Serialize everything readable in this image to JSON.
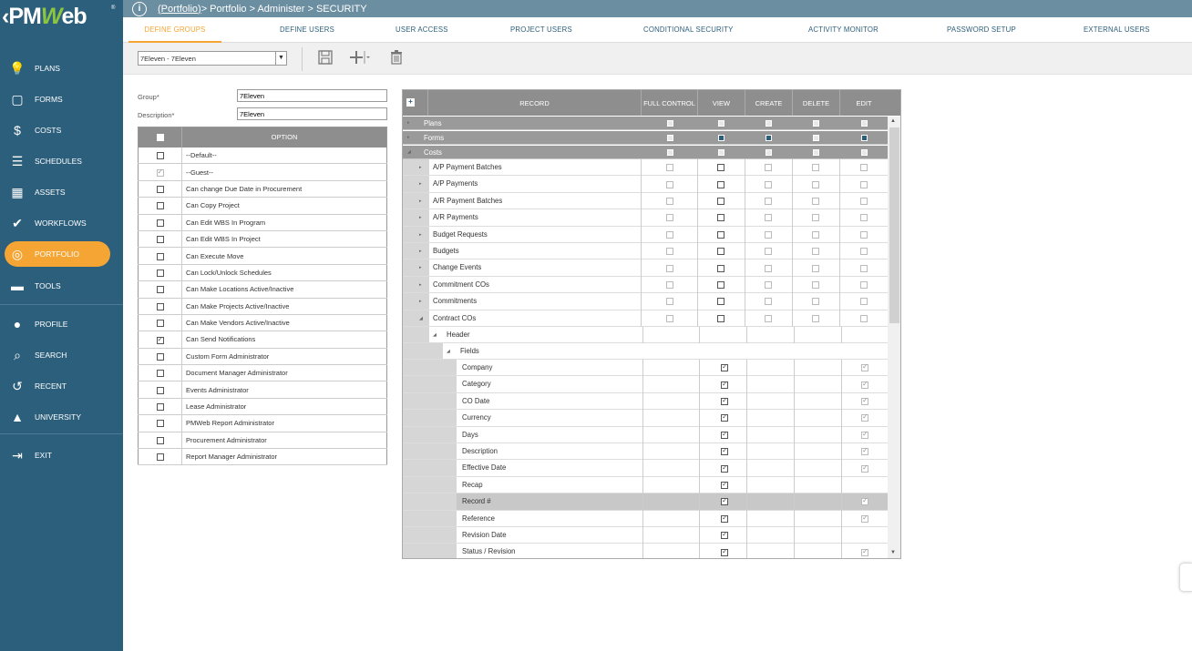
{
  "app": {
    "logo": "PMWeb",
    "reg": "®"
  },
  "breadcrumb": {
    "link": "(Portfolio)",
    "rest": " > Portfolio > Administer > SECURITY"
  },
  "nav": [
    {
      "label": "PLANS",
      "icon": "lightbulb-icon",
      "glyph": "💡"
    },
    {
      "label": "FORMS",
      "icon": "forms-icon",
      "glyph": "▢"
    },
    {
      "label": "COSTS",
      "icon": "dollar-icon",
      "glyph": "$"
    },
    {
      "label": "SCHEDULES",
      "icon": "schedules-icon",
      "glyph": "☰"
    },
    {
      "label": "ASSETS",
      "icon": "building-icon",
      "glyph": "▦"
    },
    {
      "label": "WORKFLOWS",
      "icon": "check-icon",
      "glyph": "✔"
    },
    {
      "label": "PORTFOLIO",
      "icon": "globe-icon",
      "glyph": "◎"
    },
    {
      "label": "TOOLS",
      "icon": "briefcase-icon",
      "glyph": "▬"
    },
    {
      "label": "PROFILE",
      "icon": "person-icon",
      "glyph": "●"
    },
    {
      "label": "SEARCH",
      "icon": "search-icon",
      "glyph": "⌕"
    },
    {
      "label": "RECENT",
      "icon": "history-icon",
      "glyph": "↺"
    },
    {
      "label": "UNIVERSITY",
      "icon": "graduation-cap-icon",
      "glyph": "▲"
    },
    {
      "label": "EXIT",
      "icon": "exit-icon",
      "glyph": "⇥"
    }
  ],
  "tabs": [
    "DEFINE GROUPS",
    "DEFINE USERS",
    "USER ACCESS",
    "PROJECT USERS",
    "CONDITIONAL SECURITY",
    "ACTIVITY MONITOR",
    "PASSWORD SETUP",
    "EXTERNAL USERS"
  ],
  "toolbar": {
    "group_value": "7Eleven - 7Eleven"
  },
  "form": {
    "group_label": "Group*",
    "group_value": "7Eleven",
    "desc_label": "Description*",
    "desc_value": "7Eleven"
  },
  "options": {
    "header": "OPTION",
    "rows": [
      {
        "label": "--Default--",
        "checked": false
      },
      {
        "label": "--Guest--",
        "checked": true,
        "light": true
      },
      {
        "label": "Can change Due Date in Procurement",
        "checked": false
      },
      {
        "label": "Can Copy Project",
        "checked": false
      },
      {
        "label": "Can Edit WBS In Program",
        "checked": false
      },
      {
        "label": "Can Edit WBS In Project",
        "checked": false
      },
      {
        "label": "Can Execute Move",
        "checked": false
      },
      {
        "label": "Can Lock/Unlock Schedules",
        "checked": false
      },
      {
        "label": "Can Make Locations Active/Inactive",
        "checked": false
      },
      {
        "label": "Can Make Projects Active/Inactive",
        "checked": false
      },
      {
        "label": "Can Make Vendors Active/Inactive",
        "checked": false
      },
      {
        "label": "Can Send Notifications",
        "checked": true
      },
      {
        "label": "Custom Form Administrator",
        "checked": false
      },
      {
        "label": "Document Manager Administrator",
        "checked": false
      },
      {
        "label": "Events Administrator",
        "checked": false
      },
      {
        "label": "Lease Administrator",
        "checked": false
      },
      {
        "label": "PMWeb Report Administrator",
        "checked": false
      },
      {
        "label": "Procurement Administrator",
        "checked": false
      },
      {
        "label": "Report Manager Administrator",
        "checked": false
      }
    ]
  },
  "grid": {
    "headers": {
      "record": "RECORD",
      "full": "FULL CONTROL",
      "view": "VIEW",
      "create": "CREATE",
      "delete": "DELETE",
      "edit": "EDIT"
    },
    "top_rows": [
      {
        "label": "Plans",
        "checks": [
          0,
          0,
          0,
          0,
          0
        ]
      },
      {
        "label": "Forms",
        "checks": [
          0,
          1,
          1,
          0,
          1
        ]
      },
      {
        "label": "Costs",
        "checks": [
          0,
          0,
          0,
          0,
          0
        ]
      }
    ],
    "cost_rows": [
      "A/P Payment Batches",
      "A/P Payments",
      "A/R Payment Batches",
      "A/R Payments",
      "Budget Requests",
      "Budgets",
      "Change Events",
      "Commitment COs",
      "Commitments",
      "Contract COs"
    ],
    "header_row": "Header",
    "fields_row": "Fields",
    "field_rows": [
      {
        "label": "Company",
        "view": true,
        "edit": true
      },
      {
        "label": "Category",
        "view": true,
        "edit": true
      },
      {
        "label": "CO Date",
        "view": true,
        "edit": true
      },
      {
        "label": "Currency",
        "view": true,
        "edit": true
      },
      {
        "label": "Days",
        "view": true,
        "edit": true
      },
      {
        "label": "Description",
        "view": true,
        "edit": true
      },
      {
        "label": "Effective Date",
        "view": true,
        "edit": true
      },
      {
        "label": "Recap",
        "view": true,
        "edit": false
      },
      {
        "label": "Record #",
        "view": true,
        "edit": true,
        "selected": true
      },
      {
        "label": "Reference",
        "view": true,
        "edit": true
      },
      {
        "label": "Revision Date",
        "view": true,
        "edit": false
      },
      {
        "label": "Status / Revision",
        "view": true,
        "edit": true
      }
    ]
  }
}
